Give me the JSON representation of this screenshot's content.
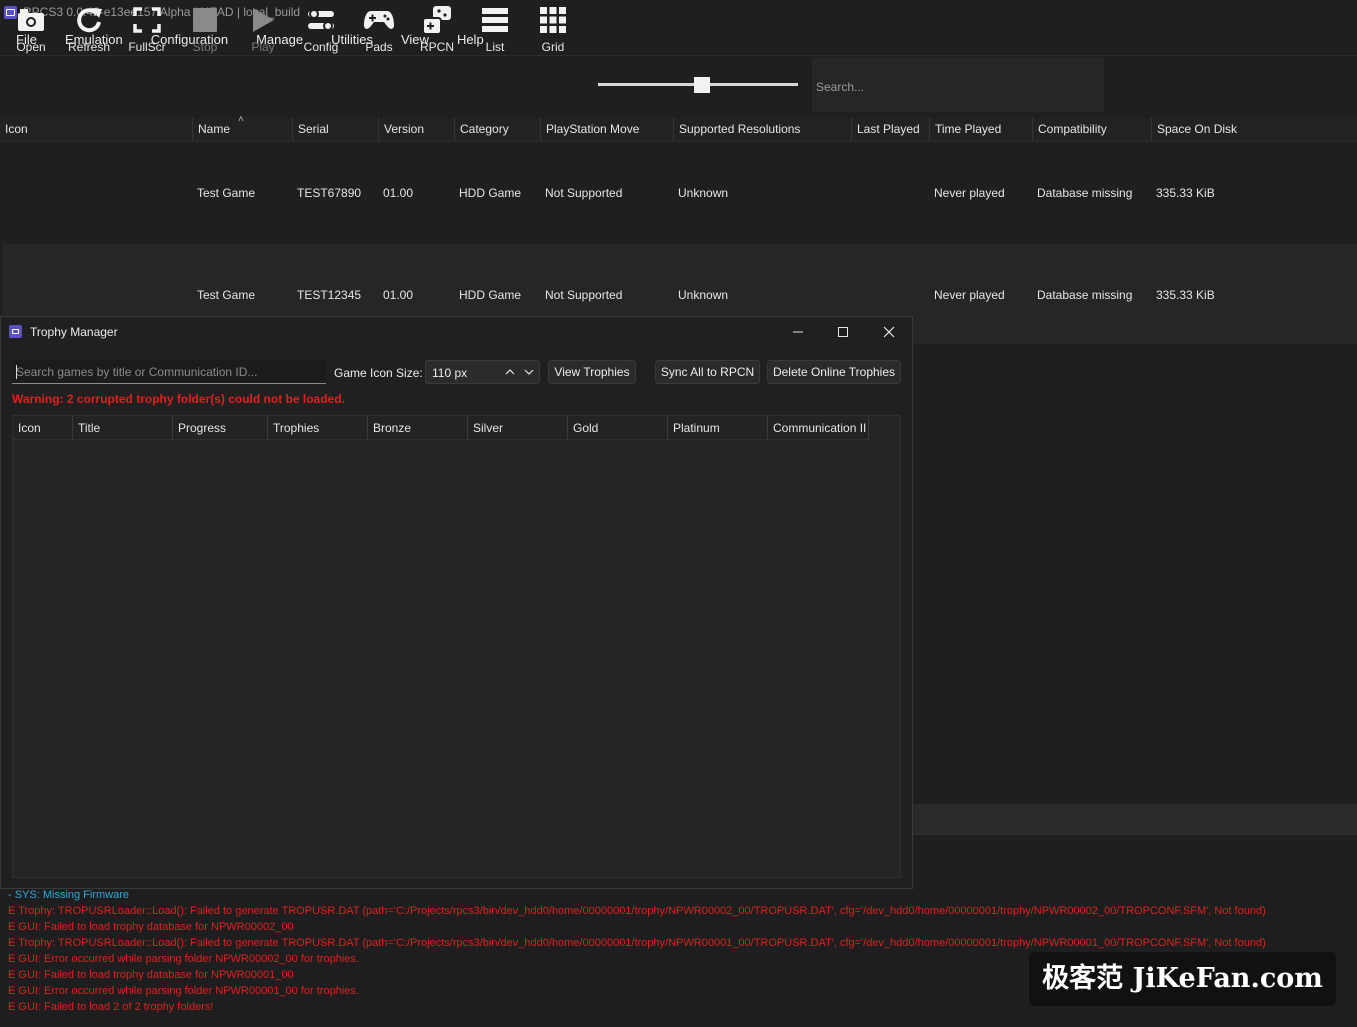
{
  "window": {
    "title": "RPCS3 0.0.42-e13ee157 Alpha | HEAD | local_build"
  },
  "menu": [
    "File",
    "Emulation",
    "Configuration",
    "Manage",
    "Utilities",
    "View",
    "Help"
  ],
  "toolbar": {
    "open": "Open",
    "refresh": "Refresh",
    "fullscr": "FullScr",
    "stop": "Stop",
    "play": "Play",
    "config": "Config",
    "pads": "Pads",
    "rpcn": "RPCN",
    "list": "List",
    "grid": "Grid",
    "search_placeholder": "Search..."
  },
  "game_list": {
    "columns": [
      "Icon",
      "Name",
      "Serial",
      "Version",
      "Category",
      "PlayStation Move",
      "Supported Resolutions",
      "Last Played",
      "Time Played",
      "Compatibility",
      "Space On Disk"
    ],
    "sort_indicator": "˄",
    "rows": [
      {
        "name": "Test Game",
        "serial": "TEST67890",
        "version": "01.00",
        "category": "HDD Game",
        "move": "Not Supported",
        "resolutions": "Unknown",
        "last_played": "",
        "time_played": "Never played",
        "compatibility": "Database missing",
        "space": "335.33 KiB"
      },
      {
        "name": "Test Game",
        "serial": "TEST12345",
        "version": "01.00",
        "category": "HDD Game",
        "move": "Not Supported",
        "resolutions": "Unknown",
        "last_played": "",
        "time_played": "Never played",
        "compatibility": "Database missing",
        "space": "335.33 KiB"
      }
    ]
  },
  "trophy_manager": {
    "title": "Trophy Manager",
    "search_placeholder": "Search games by title or Communication ID...",
    "icon_size_label": "Game Icon Size:",
    "icon_size_value": "110 px",
    "view_trophies": "View Trophies",
    "sync_all": "Sync All to RPCN",
    "delete_online": "Delete Online Trophies",
    "warning": "Warning: 2 corrupted trophy folder(s) could not be loaded.",
    "columns": [
      "Icon",
      "Title",
      "Progress",
      "Trophies",
      "Bronze",
      "Silver",
      "Gold",
      "Platinum",
      "Communication II"
    ]
  },
  "log": [
    {
      "level": "sys",
      "text": "- SYS: Missing Firmware"
    },
    {
      "level": "err",
      "text": "E Trophy: TROPUSRLoader::Load(): Failed to generate TROPUSR.DAT (path='C:/Projects/rpcs3/bin/dev_hdd0/home/00000001/trophy/NPWR00002_00/TROPUSR.DAT', cfg='/dev_hdd0/home/00000001/trophy/NPWR00002_00/TROPCONF.SFM', Not found)"
    },
    {
      "level": "err",
      "text": "E GUI: Failed to load trophy database for NPWR00002_00"
    },
    {
      "level": "err",
      "text": "E Trophy: TROPUSRLoader::Load(): Failed to generate TROPUSR.DAT (path='C:/Projects/rpcs3/bin/dev_hdd0/home/00000001/trophy/NPWR00001_00/TROPUSR.DAT', cfg='/dev_hdd0/home/00000001/trophy/NPWR00001_00/TROPCONF.SFM', Not found)"
    },
    {
      "level": "err",
      "text": "E GUI: Error occurred while parsing folder NPWR00002_00 for trophies."
    },
    {
      "level": "err",
      "text": "E GUI: Failed to load trophy database for NPWR00001_00"
    },
    {
      "level": "err",
      "text": "E GUI: Error occurred while parsing folder NPWR00001_00 for trophies."
    },
    {
      "level": "err",
      "text": "E GUI: Failed to load 2 of 2 trophy folders!"
    }
  ],
  "watermark": "极客范 JiKeFan.com",
  "colors": {
    "accent": "#5a4fcf",
    "error": "#d92222",
    "sys": "#2ea8d8"
  },
  "icons": [
    "camera-icon",
    "refresh-icon",
    "fullscreen-icon",
    "stop-icon",
    "play-icon",
    "config-icon",
    "gamepad-icon",
    "rpcn-icon",
    "list-icon",
    "grid-icon"
  ]
}
